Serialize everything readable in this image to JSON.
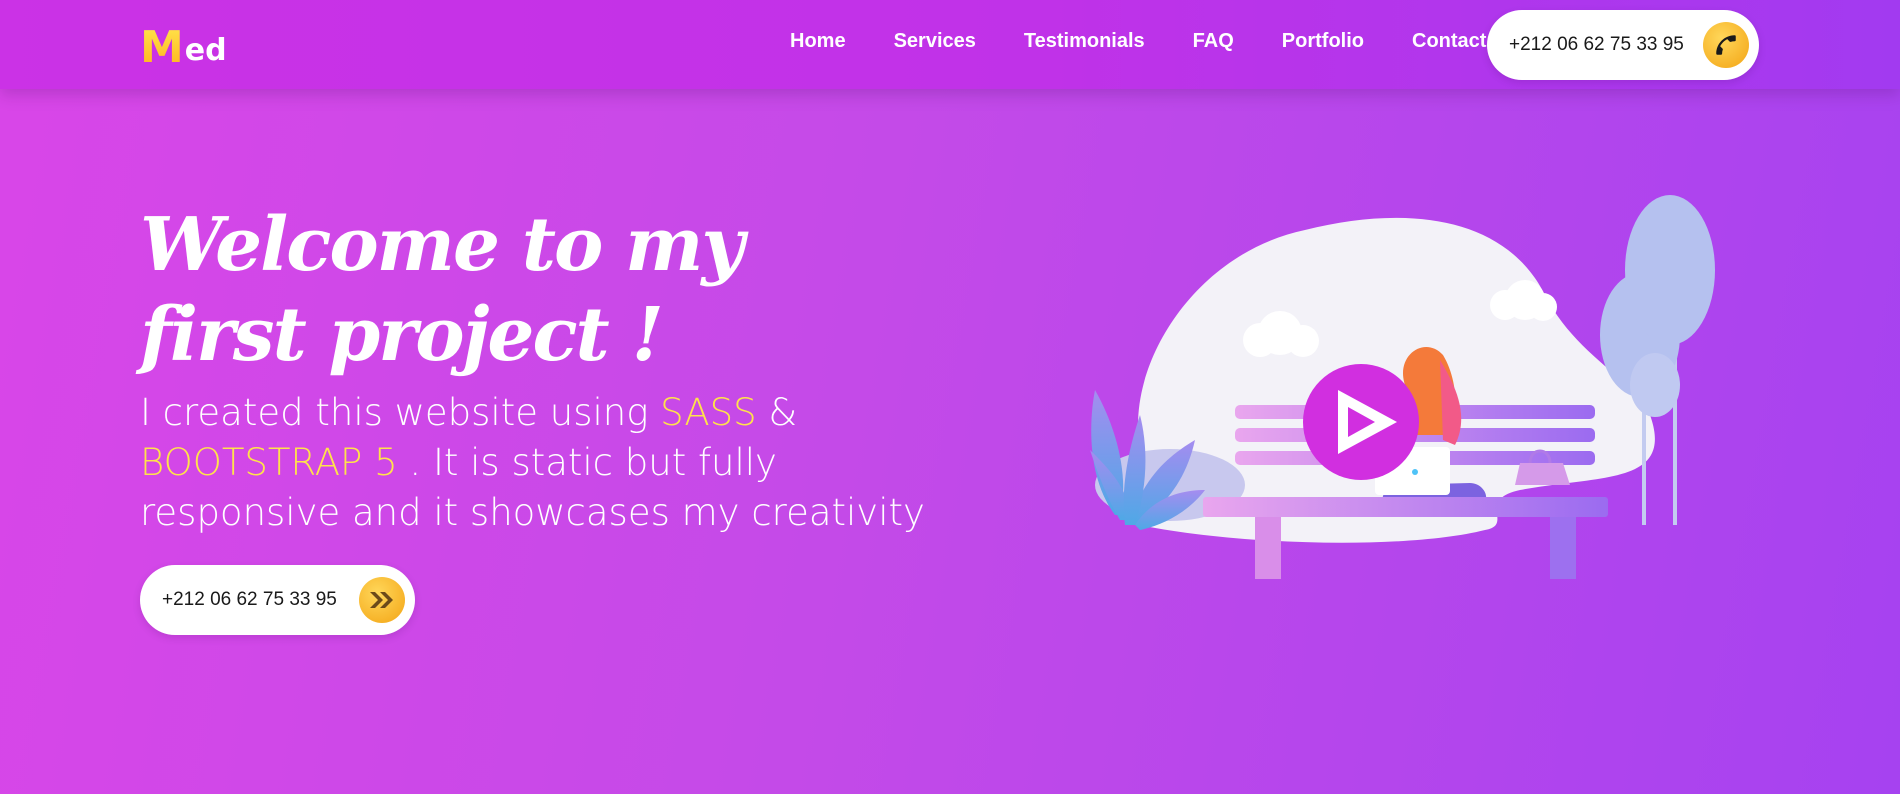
{
  "brand": {
    "logo_first": "M",
    "logo_rest": "ed"
  },
  "nav": {
    "links": [
      "Home",
      "Services",
      "Testimonials",
      "FAQ",
      "Portfolio",
      "Contact"
    ],
    "phone": "+212 06 62 75 33 95",
    "phone_icon": "phone-icon"
  },
  "hero": {
    "title": "Welcome to my first project !",
    "desc_part1": "I created this website using ",
    "desc_sass": "SASS",
    "desc_part2": " & ",
    "desc_bootstrap": "BOOTSTRAP 5",
    "desc_part3": " . It is static but fully responsive and it showcases my creativity",
    "cta_phone": "+212 06 62 75 33 95",
    "cta_icon": "double-chevron-right-icon"
  },
  "illustration": {
    "play_icon": "play-icon"
  },
  "colors": {
    "accent": "#ffe34a",
    "brand": "#c032e8",
    "play": "#d12fe0"
  }
}
